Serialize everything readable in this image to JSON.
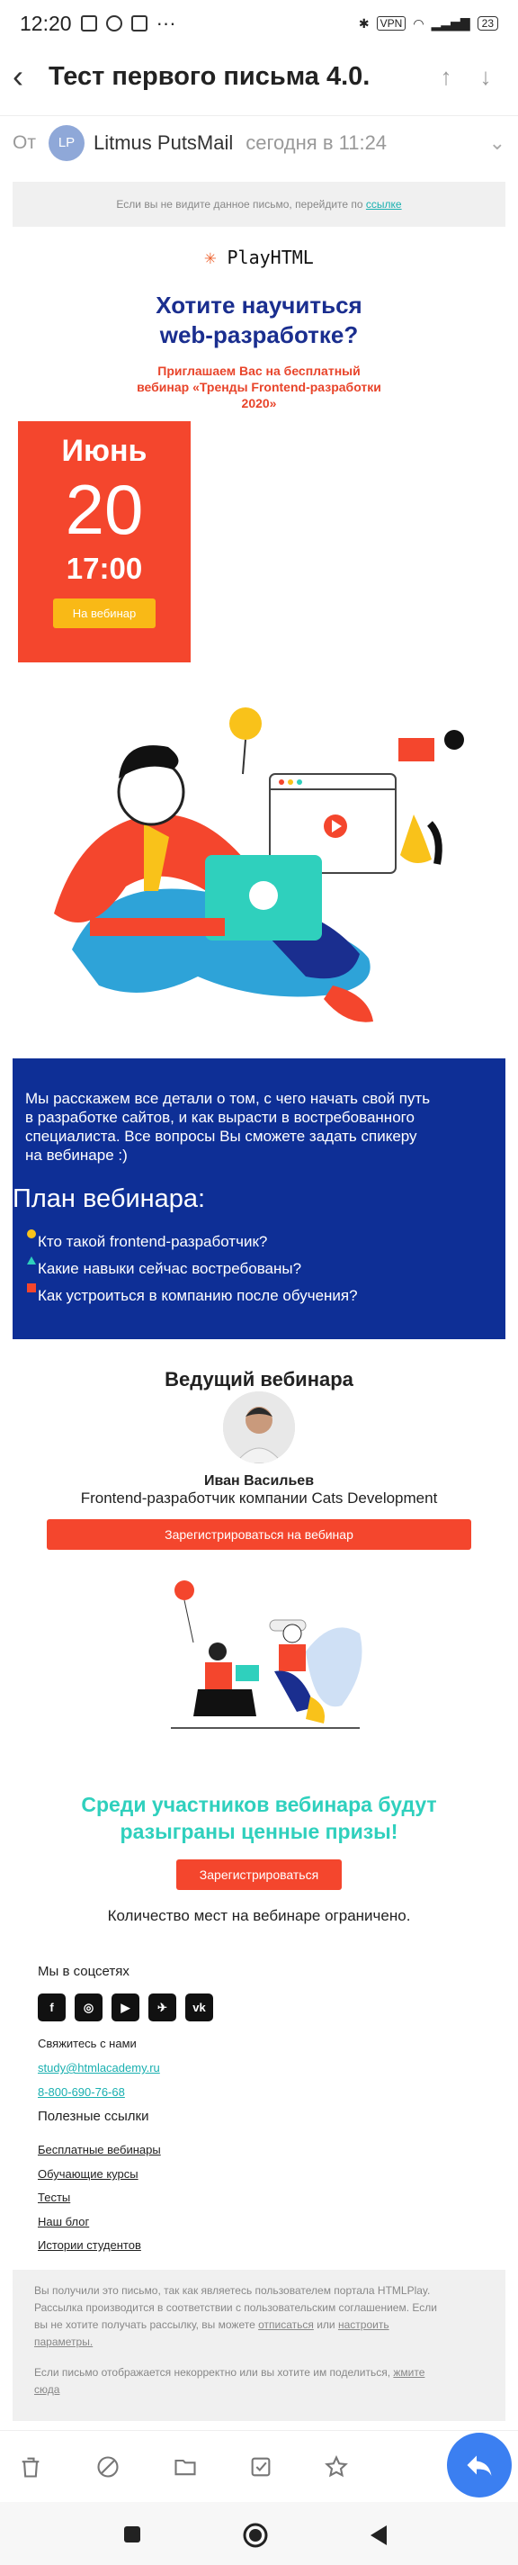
{
  "status": {
    "time": "12:20",
    "vpn": "VPN",
    "battery": "23"
  },
  "header": {
    "subject": "Тест первого письма 4.0.",
    "from_label": "От",
    "avatar": "LP",
    "sender": "Litmus PutsMail",
    "sent_at": "сегодня в 11:24"
  },
  "email": {
    "preheader_text": "Если вы не видите данное письмо, перейдите по",
    "preheader_link": "ссылке",
    "logo": "PlayHTML",
    "headline_1": "Хотите научиться",
    "headline_2": "web-разработке?",
    "invite_1": "Приглашаем Вас на бесплатный",
    "invite_2": "вебинар «Тренды Frontend-разработки",
    "invite_3": "2020»",
    "date": {
      "month": "Июнь",
      "day": "20",
      "time": "17:00",
      "button": "На вебинар"
    },
    "about_1": "Мы расскажем все детали о том, с чего начать свой путь",
    "about_2": "в разработке сайтов, и как вырасти в востребованного",
    "about_3": "специалиста. Все вопросы Вы сможете задать спикеру",
    "about_4": "на вебинаре :)",
    "plan_title": "План вебинара:",
    "plan": [
      "Кто такой frontend-разработчик?",
      "Какие навыки сейчас востребованы?",
      "Как устроиться в компанию после обучения?"
    ],
    "speaker_heading": "Ведущий вебинара",
    "speaker_name": "Иван Васильев",
    "speaker_role": "Frontend-разработчик компании Cats Development",
    "register_wide": "Зарегистрироваться на вебинар",
    "prize_1": "Среди участников вебинара будут",
    "prize_2": "разыграны ценные призы!",
    "register_short": "Зарегистрироваться",
    "limited": "Количество мест на вебинаре ограничено.",
    "social_heading": "Мы в соцсетях",
    "social": [
      "f",
      "◎",
      "▶",
      "✈",
      "vk"
    ],
    "contact_heading": "Свяжитесь с нами",
    "email_addr": "study@htmlacademy.ru",
    "phone": "8-800-690-76-68",
    "links_heading": "Полезные ссылки",
    "links": [
      "Бесплатные вебинары",
      "Обучающие курсы",
      "Тесты",
      "Наш блог",
      "Истории студентов"
    ],
    "legal_1": "Вы получили это письмо, так как являетесь пользователем портала HTMLPlay.",
    "legal_2": "Рассылка производится в соответствии с пользовательским соглашением. Если",
    "legal_3a": "вы не хотите получать рассылку, вы можете",
    "legal_unsub": "отписаться",
    "legal_or": "или",
    "legal_settings_1": "настроить",
    "legal_settings_2": "параметры.",
    "legal_4": "Если письмо отображается некорректно или вы хотите им поделиться,",
    "legal_here_1": "жмите",
    "legal_here_2": "сюда"
  },
  "toolbar": [
    "delete-icon",
    "spam-icon",
    "folder-icon",
    "mark-read-icon",
    "star-icon"
  ],
  "colors": {
    "accent_red": "#f4462d",
    "navy": "#0e2f96",
    "teal": "#2fd0bd",
    "fab": "#3b7ff1"
  }
}
